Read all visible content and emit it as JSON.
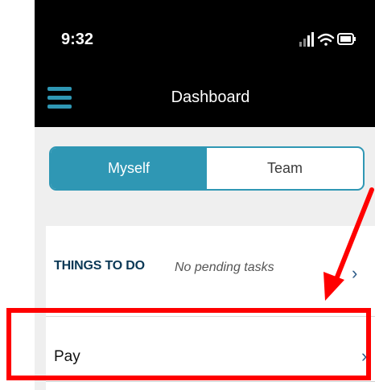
{
  "status_bar": {
    "time": "9:32"
  },
  "nav": {
    "title": "Dashboard",
    "menu_icon": "hamburger-menu-icon"
  },
  "segmented": {
    "options": [
      "Myself",
      "Team"
    ],
    "selected": "Myself"
  },
  "things_to_do": {
    "label": "THINGS TO DO",
    "value": "No pending tasks"
  },
  "pay": {
    "label": "Pay"
  },
  "colors": {
    "accent": "#2f97b4",
    "header_bg": "#000000",
    "annotation": "#ff0000",
    "heading_text": "#0a3856"
  },
  "annotation": {
    "type": "red-arrow-and-box",
    "target": "pay-row"
  }
}
